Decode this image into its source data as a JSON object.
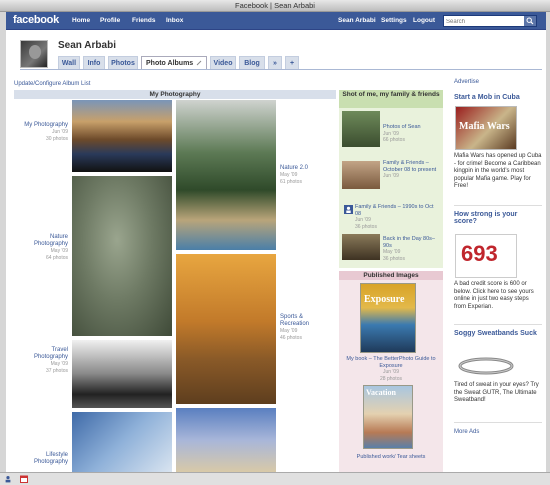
{
  "window": {
    "title": "Facebook | Sean Arbabi"
  },
  "topbar": {
    "logo": "facebook",
    "nav": [
      "Home",
      "Profile",
      "Friends",
      "Inbox"
    ],
    "right_nav": [
      "Sean Arbabi",
      "Settings",
      "Logout"
    ],
    "search_placeholder": "Search"
  },
  "profile": {
    "name": "Sean Arbabi",
    "tabs": [
      "Wall",
      "Info",
      "Photos",
      "Photo Albums",
      "Video",
      "Blog",
      "»",
      "+"
    ],
    "active_tab": "Photo Albums"
  },
  "page": {
    "update_link": "Update/Configure Album List",
    "section_title": "My Photography",
    "albums": [
      {
        "title": "My Photography",
        "date": "Jun '09",
        "count": "30 photos"
      },
      {
        "title": "Nature 2.0",
        "date": "May '09",
        "count": "61 photos"
      },
      {
        "title": "Nature Photography",
        "date": "May '09",
        "count": "64 photos"
      },
      {
        "title": "Sports & Recreation",
        "date": "May '09",
        "count": "46 photos"
      },
      {
        "title": "Travel Photography",
        "date": "May '09",
        "count": "37 photos"
      },
      {
        "title": "Lifestyle Photography",
        "date": "",
        "count": ""
      }
    ]
  },
  "shots_panel": {
    "title": "Shot of me, my family & friends",
    "items": [
      {
        "title": "Photos of Sean",
        "date": "Jun '09",
        "count": "66 photos"
      },
      {
        "title": "Family & Friends – October 08 to present",
        "date": "Jun '09",
        "count": ""
      },
      {
        "title": "Family & Friends – 1990s to Oct 08",
        "date": "Jun '09",
        "count": "36 photos"
      },
      {
        "title": "Back in the Day 80s–90s",
        "date": "May '09",
        "count": "36 photos"
      }
    ]
  },
  "published_panel": {
    "title": "Published Images",
    "book_cover_title": "Exposure",
    "book_caption": "My book – The BetterPhoto Guide to Exposure",
    "book_date": "Jun '09",
    "book_count": "28 photos",
    "magazine_title": "Vacation",
    "magazine_caption": "Published work/ Tear sheets"
  },
  "ads": {
    "label": "Advertise",
    "items": [
      {
        "title": "Start a Mob in Cuba",
        "image_text": "Mafia Wars",
        "body": "Mafia Wars has opened up Cuba - for crime! Become a Caribbean kingpin in the world's most popular Mafia game. Play for Free!"
      },
      {
        "title": "How strong is your score?",
        "image_text": "693",
        "body": "A bad credit score is 600 or below. Click here to see yours online in just two easy steps from Experian."
      },
      {
        "title": "Soggy Sweatbands Suck",
        "image_text": "",
        "body": "Tired of sweat in your eyes? Try the Sweat GUTR, The Ultimate Sweatband!"
      }
    ],
    "more": "More Ads"
  },
  "colors": {
    "fb_blue": "#3b5998",
    "link": "#3b5998",
    "green_panel": "#e9f2dc",
    "pink_panel": "#f4e6ea"
  },
  "icons": [
    "search-icon",
    "pencil-icon",
    "people-icon",
    "calendar-icon"
  ]
}
